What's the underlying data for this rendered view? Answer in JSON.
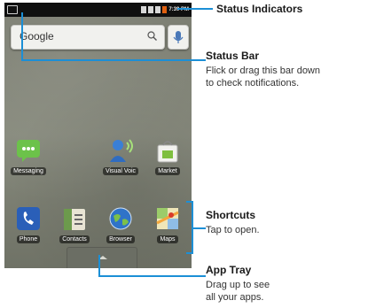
{
  "phone": {
    "status_bar": {
      "time": "7:39 PM"
    },
    "search": {
      "text": "Google"
    },
    "apps_row1": [
      {
        "label": "Messaging",
        "icon": "messaging-icon"
      },
      {
        "label": "Visual Voic",
        "icon": "visual-voicemail-icon"
      },
      {
        "label": "Market",
        "icon": "market-icon"
      }
    ],
    "apps_row2": [
      {
        "label": "Phone",
        "icon": "phone-icon"
      },
      {
        "label": "Contacts",
        "icon": "contacts-icon"
      },
      {
        "label": "Browser",
        "icon": "browser-icon"
      },
      {
        "label": "Maps",
        "icon": "maps-icon"
      }
    ]
  },
  "annotations": {
    "status_indicators": {
      "title": "Status Indicators"
    },
    "status_bar": {
      "title": "Status Bar",
      "body_line1": "Flick or drag this bar down",
      "body_line2": "to check notifications."
    },
    "shortcuts": {
      "title": "Shortcuts",
      "body": "Tap to open."
    },
    "app_tray": {
      "title": "App Tray",
      "body_line1": "Drag up to see",
      "body_line2": "all your apps."
    }
  },
  "colors": {
    "callout": "#1c8fd6",
    "wallpaper": "#7f8176"
  }
}
